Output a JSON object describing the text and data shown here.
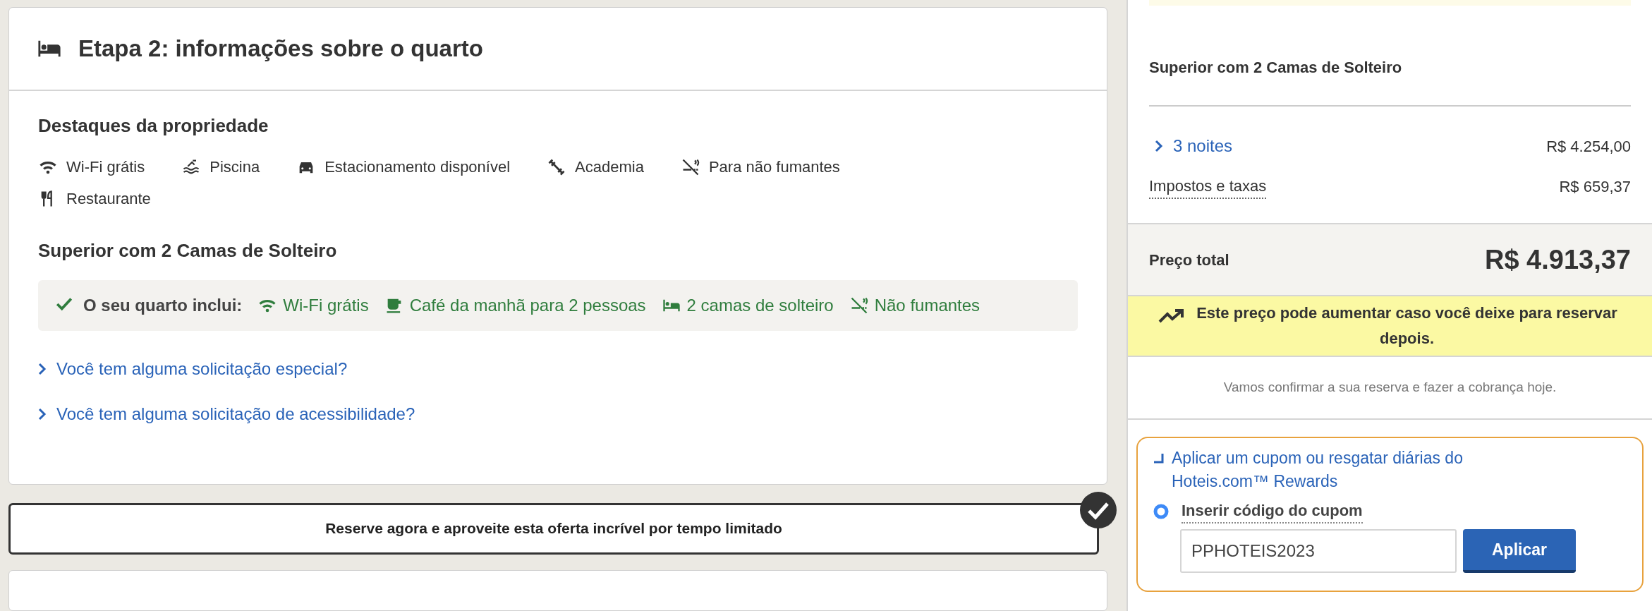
{
  "step_header": {
    "title": "Etapa 2: informações sobre o quarto"
  },
  "highlights": {
    "title": "Destaques da propriedade",
    "items": [
      {
        "kind": "wifi",
        "label": "Wi-Fi grátis"
      },
      {
        "kind": "pool",
        "label": "Piscina"
      },
      {
        "kind": "car",
        "label": "Estacionamento disponível"
      },
      {
        "kind": "gym",
        "label": "Academia"
      },
      {
        "kind": "nosmoking",
        "label": "Para não fumantes"
      },
      {
        "kind": "restaurant",
        "label": "Restaurante"
      }
    ]
  },
  "room": {
    "title": "Superior com 2 Camas de Solteiro",
    "includes": {
      "label": "O seu quarto inclui:",
      "items": [
        {
          "kind": "wifi",
          "label": "Wi-Fi grátis"
        },
        {
          "kind": "coffee",
          "label": "Café da manhã para 2 pessoas"
        },
        {
          "kind": "bed",
          "label": "2 camas de solteiro"
        },
        {
          "kind": "nosmoking",
          "label": "Não fumantes"
        }
      ]
    }
  },
  "requests": [
    "Você tem alguma solicitação especial?",
    "Você tem alguma solicitação de acessibilidade?"
  ],
  "offer_banner": {
    "text": "Reserve agora e aproveite esta oferta incrível por tempo limitado"
  },
  "summary": {
    "room_title": "Superior com 2 Camas de Solteiro",
    "lines": [
      {
        "kind": "expandable",
        "label": "3 noites",
        "amount": "R$ 4.254,00"
      },
      {
        "kind": "info",
        "label": "Impostos e taxas",
        "amount": "R$ 659,37"
      }
    ],
    "total": {
      "label": "Preço total",
      "amount": "R$ 4.913,37"
    },
    "price_alert": "Este preço pode aumentar caso você deixe para reservar depois.",
    "confirm_note": "Vamos confirmar a sua reserva e fazer a cobrança hoje.",
    "coupon": {
      "toggle_label": "Aplicar um cupom ou resgatar diárias do Hoteis.com™ Rewards",
      "option": {
        "label": "Inserir código do cupom",
        "selected": true
      },
      "value": "PPHOTEIS2023",
      "button": "Aplicar"
    }
  }
}
